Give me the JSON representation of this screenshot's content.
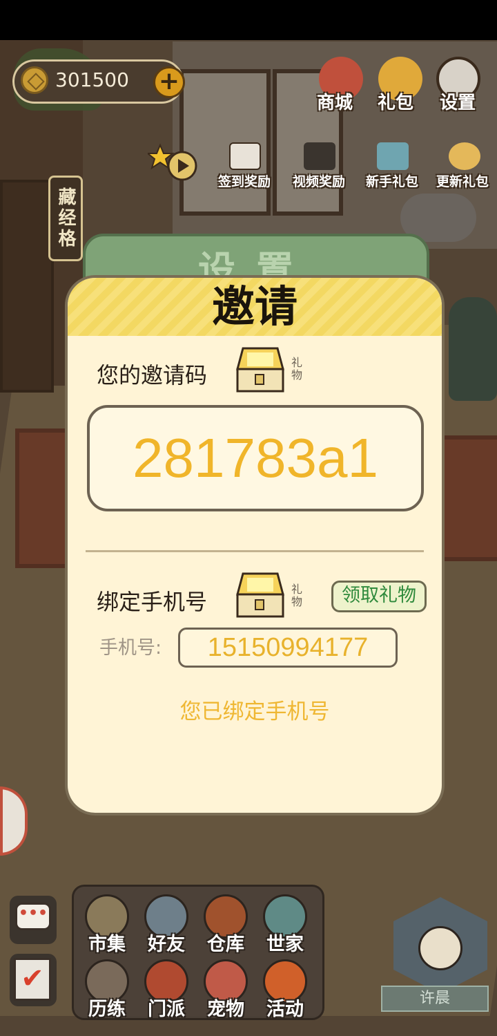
{
  "currency": {
    "amount": "301500",
    "plus_symbol": "+"
  },
  "top_menu": [
    {
      "label": "商城",
      "icon": "money-bag-icon"
    },
    {
      "label": "礼包",
      "icon": "gift-bag-icon"
    },
    {
      "label": "设置",
      "icon": "gear-icon"
    }
  ],
  "sub_menu": [
    {
      "label": "签到奖励",
      "icon": "calendar-icon"
    },
    {
      "label": "视频奖励",
      "icon": "clapperboard-icon"
    },
    {
      "label": "新手礼包",
      "icon": "treasure-chest-icon"
    },
    {
      "label": "更新礼包",
      "icon": "character-gift-icon"
    }
  ],
  "library_sign": "藏经格",
  "background_dialog_title": "设置",
  "dialog": {
    "title": "邀请",
    "invite_code_label": "您的邀请码",
    "gift_tag": "礼物",
    "invite_code": "281783a1",
    "bind_phone_label": "绑定手机号",
    "claim_button": "领取礼物",
    "phone_field_label": "手机号:",
    "phone_number": "15150994177",
    "bound_message": "您已绑定手机号"
  },
  "bottom_menu": [
    {
      "label": "市集",
      "icon": "market-stall-icon",
      "color": "#8a7a5a"
    },
    {
      "label": "好友",
      "icon": "handshake-icon",
      "color": "#6e7f8a"
    },
    {
      "label": "仓库",
      "icon": "treasure-box-icon",
      "color": "#a0522d"
    },
    {
      "label": "世家",
      "icon": "cauldron-icon",
      "color": "#5f8a86"
    },
    {
      "label": "历练",
      "icon": "crossed-swords-icon",
      "color": "#7a6a5a"
    },
    {
      "label": "门派",
      "icon": "banner-icon",
      "color": "#b04a30"
    },
    {
      "label": "宠物",
      "icon": "paw-icon",
      "color": "#c05a48"
    },
    {
      "label": "活动",
      "icon": "lantern-icon",
      "color": "#d0602a"
    }
  ],
  "chat_button_icon": "chat-bubble-icon",
  "task_button_icon": "checklist-icon",
  "player": {
    "name": "许晨"
  }
}
